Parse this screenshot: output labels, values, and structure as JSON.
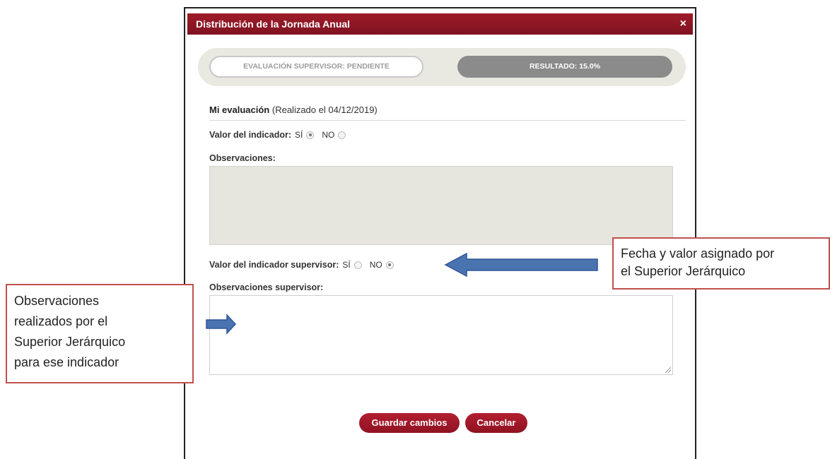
{
  "modal": {
    "title": "Distribución de la Jornada Anual",
    "close_icon": "×",
    "status": {
      "supervisor_eval": "EVALUACIÓN SUPERVISOR: PENDIENTE",
      "result": "RESULTADO: 15.0%"
    },
    "my_eval": {
      "heading": "Mi evaluación",
      "date_note": "(Realizado el 04/12/2019)",
      "indicator_label": "Valor del indicador:",
      "yes_label": "SÍ",
      "no_label": "NO",
      "selected": "SÍ",
      "observations_label": "Observaciones:",
      "observations_value": ""
    },
    "supervisor": {
      "indicator_label": "Valor del indicador supervisor:",
      "yes_label": "SÍ",
      "no_label": "NO",
      "selected": "NO",
      "observations_label": "Observaciones supervisor:",
      "observations_value": ""
    },
    "buttons": {
      "save": "Guardar cambios",
      "cancel": "Cancelar"
    }
  },
  "annotations": {
    "right_callout_line1": "Fecha y valor asignado por",
    "right_callout_line2": "el Superior Jerárquico",
    "left_callout_line1": "Observaciones",
    "left_callout_line2": "realizados por el",
    "left_callout_line3": "Superior Jerárquico",
    "left_callout_line4": "para ese indicador"
  },
  "colors": {
    "brand": "#8f1222",
    "status_filled": "#8b8b8b",
    "track": "#e9e8e1",
    "callout_border": "#c0504d",
    "arrow": "#4a74b0"
  }
}
